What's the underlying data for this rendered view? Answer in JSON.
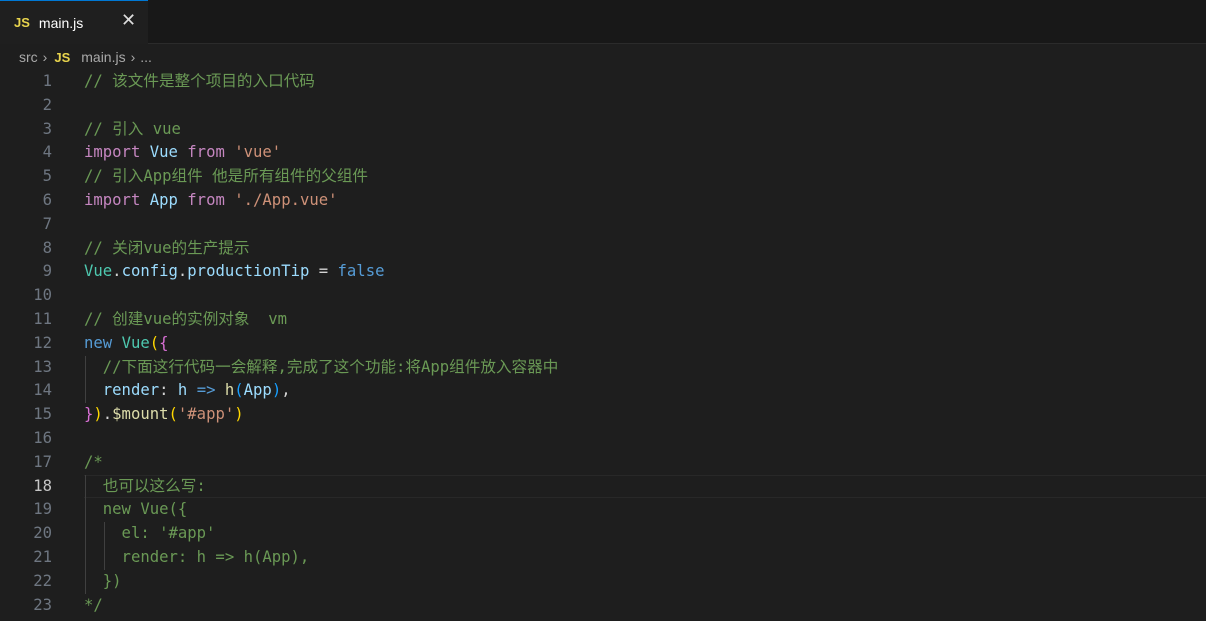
{
  "tab": {
    "icon": "JS",
    "label": "main.js",
    "close_icon": "close-icon"
  },
  "breadcrumb": {
    "folder": "src",
    "icon": "JS",
    "file": "main.js",
    "more": "..."
  },
  "active_line": 18,
  "colors": {
    "comment": "#6a9955",
    "keyword": "#c586c0",
    "builtin": "#569cd6",
    "type": "#4ec9b0",
    "variable": "#9cdcfe",
    "string": "#ce9178",
    "function": "#dcdcaa",
    "accent": "#0078d4"
  },
  "lines": [
    [
      [
        "// 该文件是整个项目的入口代码",
        "c"
      ]
    ],
    [],
    [
      [
        "// 引入 vue",
        "c"
      ]
    ],
    [
      [
        "import",
        "k"
      ],
      [
        " ",
        "w"
      ],
      [
        "Vue",
        "v"
      ],
      [
        " ",
        "w"
      ],
      [
        "from",
        "k"
      ],
      [
        " ",
        "w"
      ],
      [
        "'vue'",
        "s"
      ]
    ],
    [
      [
        "// 引入App组件 他是所有组件的父组件",
        "c"
      ]
    ],
    [
      [
        "import",
        "k"
      ],
      [
        " ",
        "w"
      ],
      [
        "App",
        "v"
      ],
      [
        " ",
        "w"
      ],
      [
        "from",
        "k"
      ],
      [
        " ",
        "w"
      ],
      [
        "'./App.vue'",
        "s"
      ]
    ],
    [],
    [
      [
        "// 关闭vue的生产提示",
        "c"
      ]
    ],
    [
      [
        "Vue",
        "t"
      ],
      [
        ".",
        "w"
      ],
      [
        "config",
        "v"
      ],
      [
        ".",
        "w"
      ],
      [
        "productionTip",
        "v"
      ],
      [
        " = ",
        "w"
      ],
      [
        "false",
        "b"
      ]
    ],
    [],
    [
      [
        "// 创建vue的实例对象  vm",
        "c"
      ]
    ],
    [
      [
        "new",
        "b"
      ],
      [
        " ",
        "w"
      ],
      [
        "Vue",
        "t"
      ],
      [
        "(",
        "y"
      ],
      [
        "{",
        "p"
      ]
    ],
    [
      [
        "  ",
        "w"
      ],
      [
        "//下面这行代码一会解释,完成了这个功能:将App组件放入容器中",
        "c"
      ]
    ],
    [
      [
        "  ",
        "w"
      ],
      [
        "render",
        "v"
      ],
      [
        ": ",
        "w"
      ],
      [
        "h",
        "v"
      ],
      [
        " ",
        "w"
      ],
      [
        "=>",
        "b"
      ],
      [
        " ",
        "w"
      ],
      [
        "h",
        "f"
      ],
      [
        "(",
        "bl"
      ],
      [
        "App",
        "v"
      ],
      [
        ")",
        "bl"
      ],
      [
        ",",
        "w"
      ]
    ],
    [
      [
        "}",
        "p"
      ],
      [
        ")",
        "y"
      ],
      [
        ".",
        "w"
      ],
      [
        "$mount",
        "f"
      ],
      [
        "(",
        "y"
      ],
      [
        "'#app'",
        "s"
      ],
      [
        ")",
        "y"
      ]
    ],
    [],
    [
      [
        "/*",
        "c"
      ]
    ],
    [
      [
        "  也可以这么写:",
        "c"
      ]
    ],
    [
      [
        "  new Vue({",
        "c"
      ]
    ],
    [
      [
        "    el: '#app'",
        "c"
      ]
    ],
    [
      [
        "    render: h => h(App),",
        "c"
      ]
    ],
    [
      [
        "  })",
        "c"
      ]
    ],
    [
      [
        "*/",
        "c"
      ]
    ]
  ]
}
